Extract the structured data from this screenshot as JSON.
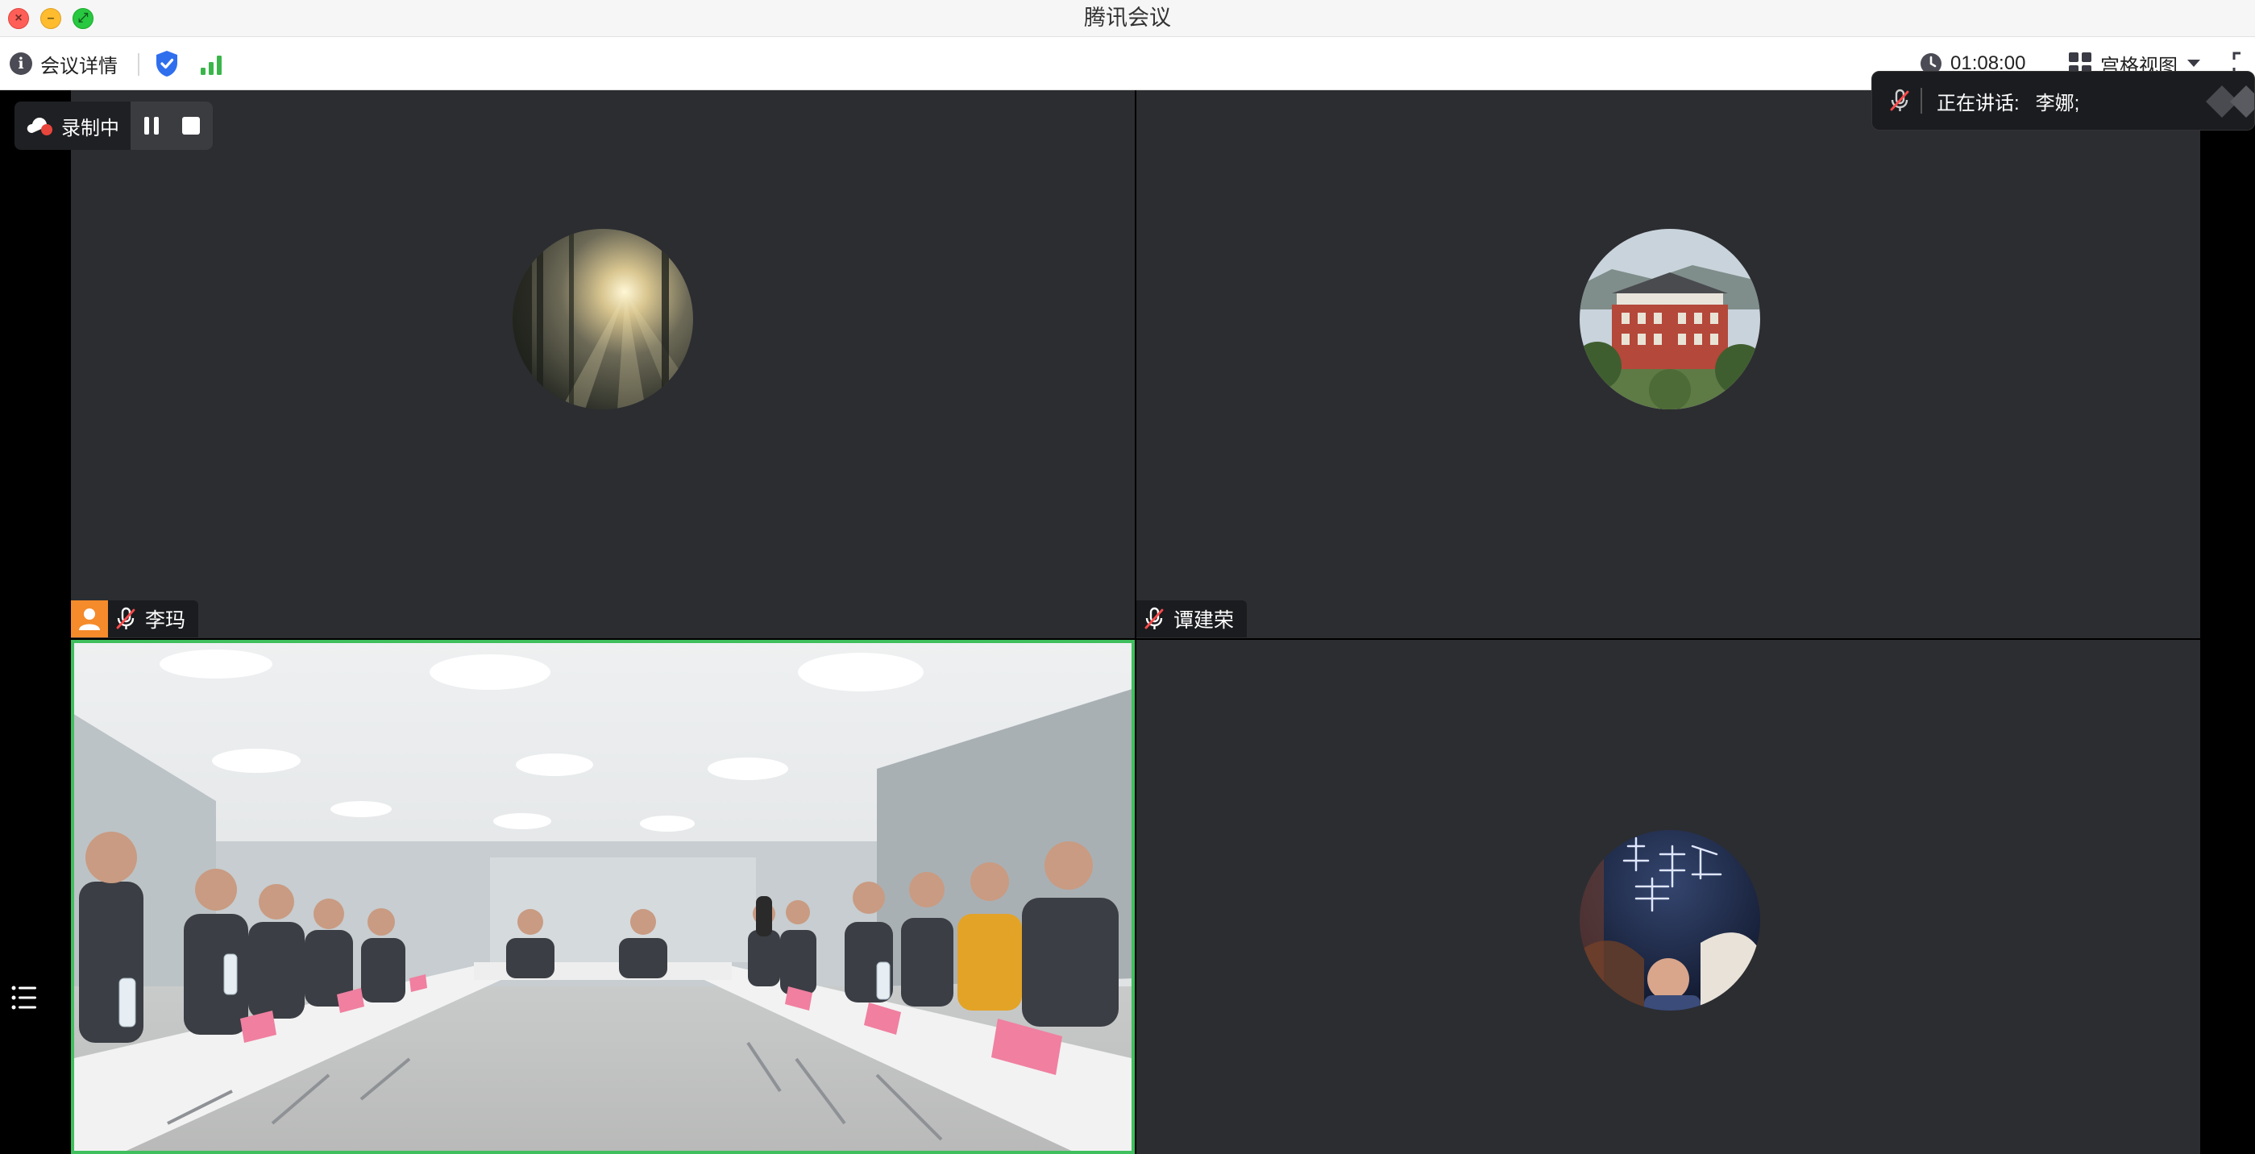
{
  "window": {
    "title": "腾讯会议"
  },
  "toolbar": {
    "meeting_details_label": "会议详情",
    "timer": "01:08:00",
    "view_mode_label": "宫格视图"
  },
  "recording": {
    "status_label": "录制中"
  },
  "speaking": {
    "label": "正在讲话:",
    "names": "李娜;"
  },
  "participants": [
    {
      "name": "李玛",
      "muted": true,
      "avatar": "forest-sunbeam"
    },
    {
      "name": "谭建荣",
      "muted": true,
      "avatar": "red-brick-building"
    },
    {
      "name": "",
      "video": "conference-room"
    },
    {
      "name": "",
      "avatar": "night-drone-show"
    }
  ],
  "colors": {
    "active_speaker_border": "#3fbf5d",
    "user_badge": "#f58b2a",
    "shield": "#2f6fee",
    "signal": "#3bb54a",
    "recording_dot": "#e8453c"
  }
}
